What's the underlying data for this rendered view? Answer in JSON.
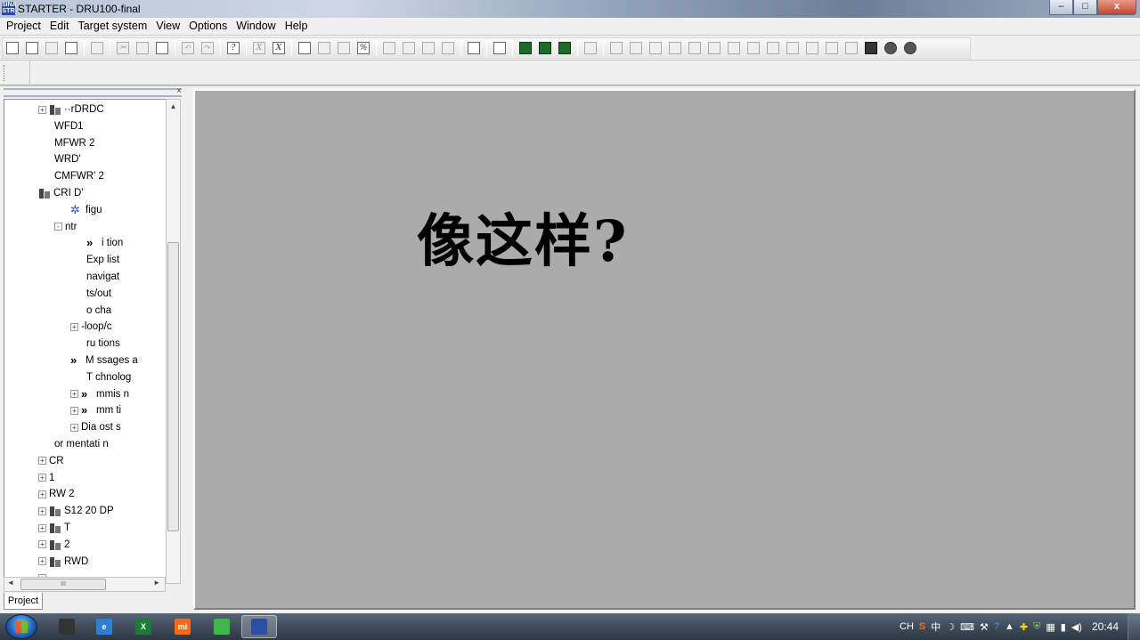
{
  "window": {
    "title": "STARTER - DRU100-final",
    "app_icon_text": "SINA\nSTR",
    "buttons": {
      "minimize": "–",
      "maximize": "□",
      "close": "x"
    }
  },
  "menu": [
    "Project",
    "Edit",
    "Target system",
    "View",
    "Options",
    "Window",
    "Help"
  ],
  "toolbar": {
    "buttons": [
      {
        "name": "new-icon",
        "glyph": "",
        "disabled": false
      },
      {
        "name": "open-icon",
        "glyph": "",
        "disabled": false
      },
      {
        "name": "save-icon",
        "glyph": "",
        "disabled": true
      },
      {
        "name": "save-compile-icon",
        "glyph": "",
        "disabled": false
      },
      {
        "name": "sep"
      },
      {
        "name": "print-icon",
        "glyph": "",
        "disabled": true
      },
      {
        "name": "sep"
      },
      {
        "name": "cut-icon",
        "glyph": "✂",
        "disabled": true
      },
      {
        "name": "copy-icon",
        "glyph": "",
        "disabled": true
      },
      {
        "name": "paste-icon",
        "glyph": "",
        "disabled": false
      },
      {
        "name": "sep"
      },
      {
        "name": "undo-icon",
        "glyph": "↶",
        "disabled": true
      },
      {
        "name": "redo-icon",
        "glyph": "↷",
        "disabled": true
      },
      {
        "name": "sep"
      },
      {
        "name": "help-icon",
        "glyph": "?",
        "disabled": false
      },
      {
        "name": "sep"
      },
      {
        "name": "subscript-x1-icon",
        "glyph": "X",
        "disabled": true
      },
      {
        "name": "subscript-xe-icon",
        "glyph": "X",
        "disabled": false
      },
      {
        "name": "sep"
      },
      {
        "name": "connect-target-icon",
        "glyph": "",
        "disabled": false
      },
      {
        "name": "load-cpu-icon",
        "glyph": "",
        "disabled": true
      },
      {
        "name": "load-pg-icon",
        "glyph": "",
        "disabled": true
      },
      {
        "name": "online-offline-icon",
        "glyph": "%",
        "disabled": false
      },
      {
        "name": "sep"
      },
      {
        "name": "download-icon",
        "glyph": "",
        "disabled": true
      },
      {
        "name": "upload-icon",
        "glyph": "",
        "disabled": true
      },
      {
        "name": "copy-ram-rom-icon",
        "glyph": "",
        "disabled": true
      },
      {
        "name": "restore-icon",
        "glyph": "",
        "disabled": true
      },
      {
        "name": "sep"
      },
      {
        "name": "device-config-icon",
        "glyph": "",
        "disabled": false
      },
      {
        "name": "sep"
      },
      {
        "name": "accessible-nodes-icon",
        "glyph": "",
        "disabled": false
      },
      {
        "name": "sep"
      },
      {
        "name": "trace-icon",
        "glyph": "",
        "disabled": false,
        "style": "green"
      },
      {
        "name": "function-gen-icon",
        "glyph": "",
        "disabled": false,
        "style": "green"
      },
      {
        "name": "measure-icon",
        "glyph": "",
        "disabled": false,
        "style": "green"
      },
      {
        "name": "sep"
      },
      {
        "name": "block-icon",
        "glyph": "",
        "disabled": true
      },
      {
        "name": "sep"
      },
      {
        "name": "dcc-1-icon",
        "glyph": "",
        "disabled": true
      },
      {
        "name": "dcc-2-icon",
        "glyph": "",
        "disabled": true
      },
      {
        "name": "dcc-3-icon",
        "glyph": "",
        "disabled": true
      },
      {
        "name": "dcc-4-icon",
        "glyph": "",
        "disabled": true
      },
      {
        "name": "dcc-5-icon",
        "glyph": "",
        "disabled": true
      },
      {
        "name": "dcc-6-icon",
        "glyph": "",
        "disabled": true
      },
      {
        "name": "dcc-7-icon",
        "glyph": "",
        "disabled": true
      },
      {
        "name": "dcc-8-icon",
        "glyph": "",
        "disabled": true
      },
      {
        "name": "dcc-9-icon",
        "glyph": "",
        "disabled": true
      },
      {
        "name": "dcc-10-icon",
        "glyph": "",
        "disabled": true
      },
      {
        "name": "dcc-11-icon",
        "glyph": "",
        "disabled": true
      },
      {
        "name": "dcc-12-icon",
        "glyph": "",
        "disabled": true
      },
      {
        "name": "dcc-13-icon",
        "glyph": "",
        "disabled": true
      },
      {
        "name": "square-icon",
        "glyph": "",
        "disabled": false,
        "style": "dark"
      },
      {
        "name": "circle-icon",
        "glyph": "",
        "disabled": false,
        "style": "circle"
      },
      {
        "name": "circle2-icon",
        "glyph": "",
        "disabled": false,
        "style": "circle"
      }
    ]
  },
  "tree": {
    "items": [
      {
        "indent": 0,
        "expander": "+",
        "icon": "device",
        "label": "··rDRDC"
      },
      {
        "indent": 1,
        "expander": "",
        "icon": "",
        "label": "WFD1"
      },
      {
        "indent": 1,
        "expander": "",
        "icon": "",
        "label": "MFWR 2"
      },
      {
        "indent": 1,
        "expander": "",
        "icon": "",
        "label": "WRD'"
      },
      {
        "indent": 1,
        "expander": "",
        "icon": "",
        "label": "CMFWR' 2"
      },
      {
        "indent": 0,
        "expander": "",
        "icon": "device",
        "label": "CRI D'"
      },
      {
        "indent": 2,
        "expander": "",
        "icon": "gear",
        "label": "figu"
      },
      {
        "indent": 1,
        "expander": "-",
        "icon": "",
        "label": "ntr"
      },
      {
        "indent": 3,
        "expander": "",
        "icon": "chev",
        "label": "i tion"
      },
      {
        "indent": 3,
        "expander": "",
        "icon": "",
        "label": "Exp list"
      },
      {
        "indent": 3,
        "expander": "",
        "icon": "",
        "label": "navigat"
      },
      {
        "indent": 3,
        "expander": "",
        "icon": "",
        "label": "ts/out"
      },
      {
        "indent": 3,
        "expander": "",
        "icon": "",
        "label": "o cha"
      },
      {
        "indent": 2,
        "expander": "+",
        "icon": "",
        "label": "-loop/c"
      },
      {
        "indent": 3,
        "expander": "",
        "icon": "",
        "label": "ru tions"
      },
      {
        "indent": 2,
        "expander": "",
        "icon": "chev",
        "label": "M ssages a"
      },
      {
        "indent": 3,
        "expander": "",
        "icon": "",
        "label": "T chnolog"
      },
      {
        "indent": 2,
        "expander": "+",
        "icon": "chev",
        "label": "mmis n"
      },
      {
        "indent": 2,
        "expander": "+",
        "icon": "chev",
        "label": "mm ti"
      },
      {
        "indent": 2,
        "expander": "+",
        "icon": "",
        "label": "Dia ost s"
      },
      {
        "indent": 1,
        "expander": "",
        "icon": "",
        "label": "or mentati n"
      },
      {
        "indent": 0,
        "expander": "+",
        "icon": "",
        "label": "CR"
      },
      {
        "indent": 0,
        "expander": "+",
        "icon": "",
        "label": "1"
      },
      {
        "indent": 0,
        "expander": "+",
        "icon": "",
        "label": "RW 2"
      },
      {
        "indent": 0,
        "expander": "+",
        "icon": "device",
        "label": "S12 20 DP"
      },
      {
        "indent": 0,
        "expander": "+",
        "icon": "device",
        "label": "T"
      },
      {
        "indent": 0,
        "expander": "+",
        "icon": "device",
        "label": "2"
      },
      {
        "indent": 0,
        "expander": "+",
        "icon": "device",
        "label": "RWD"
      },
      {
        "indent": 0,
        "expander": "+",
        "icon": "",
        "label": ""
      }
    ],
    "tab": "Project",
    "hscroll_thumb": "III"
  },
  "workspace": {
    "overlay_text": "像这样?"
  },
  "taskbar": {
    "apps": [
      {
        "name": "starter-taskbar-icon",
        "label": "",
        "color": "#333"
      },
      {
        "name": "ie-taskbar-icon",
        "label": "e",
        "color": "#2f7fd6"
      },
      {
        "name": "excel-taskbar-icon",
        "label": "X",
        "color": "#1e7a36"
      },
      {
        "name": "mi-taskbar-icon",
        "label": "mi",
        "color": "#f26b1d"
      },
      {
        "name": "wechat-taskbar-icon",
        "label": "",
        "color": "#3fb54a"
      },
      {
        "name": "starter-active-taskbar-icon",
        "label": "",
        "color": "#2b4ea3"
      }
    ],
    "tray": {
      "lang": "CH",
      "ime": "中",
      "clock": "20:44"
    }
  }
}
